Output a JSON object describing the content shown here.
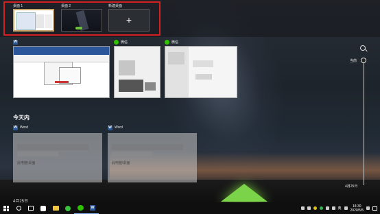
{
  "desktops": [
    {
      "label": "桌面 1",
      "active": true
    },
    {
      "label": "桌面 2",
      "active": false
    },
    {
      "label": "新建桌面",
      "add_glyph": "+"
    }
  ],
  "windows": [
    {
      "app": "Word",
      "icon": "word-icon",
      "title": ""
    },
    {
      "app": "微信",
      "icon": "wechat-icon",
      "title": "微信"
    },
    {
      "app": "微信",
      "icon": "wechat-icon",
      "title": "微信"
    }
  ],
  "timeline": {
    "section_today": "今天内",
    "cards": [
      {
        "app": "Word",
        "location": "此电脑\\桌面"
      },
      {
        "app": "Word",
        "location": "此电脑\\桌面"
      }
    ],
    "section_next": "4月25日",
    "now_label": "当前",
    "date_label": "4月25日"
  },
  "taskbar": {
    "time": "18:30",
    "date": "2020/5/5",
    "ime": "英"
  },
  "colors": {
    "highlight_box": "#d42020",
    "word_blue": "#2b579a",
    "wechat_green": "#2dc100"
  }
}
